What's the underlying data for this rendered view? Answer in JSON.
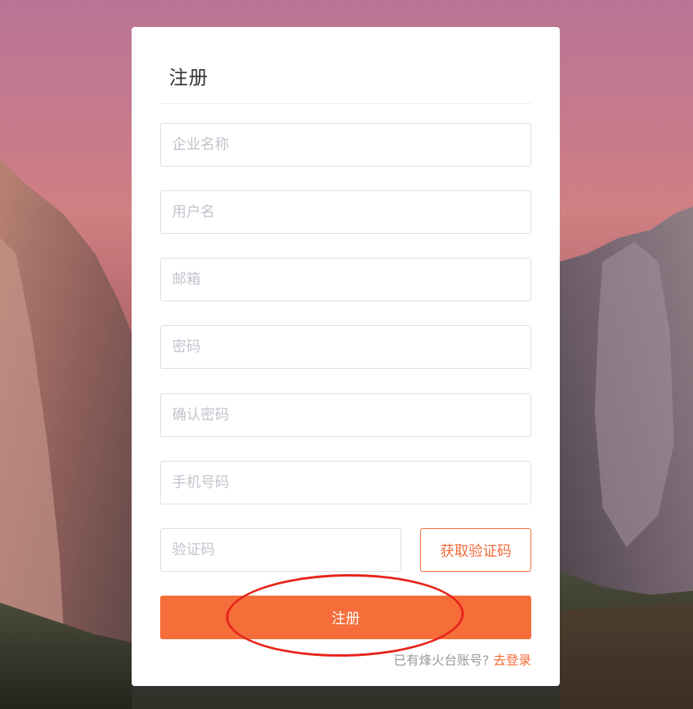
{
  "colors": {
    "accent": "#f26c3a",
    "button_fill": "#f56e3a",
    "annotation_circle": "#e8241a"
  },
  "background": {
    "description_icon": "mountain-landscape-image"
  },
  "form": {
    "title": "注册",
    "fields": {
      "company": {
        "placeholder": "企业名称",
        "value": ""
      },
      "username": {
        "placeholder": "用户名",
        "value": ""
      },
      "email": {
        "placeholder": "邮箱",
        "value": ""
      },
      "password": {
        "placeholder": "密码",
        "value": ""
      },
      "confirm_password": {
        "placeholder": "确认密码",
        "value": ""
      },
      "phone": {
        "placeholder": "手机号码",
        "value": ""
      },
      "code": {
        "placeholder": "验证码",
        "value": ""
      }
    },
    "get_code_label": "获取验证码",
    "submit_label": "注册",
    "login_prompt": "已有烽火台账号? ",
    "login_link": "去登录"
  }
}
